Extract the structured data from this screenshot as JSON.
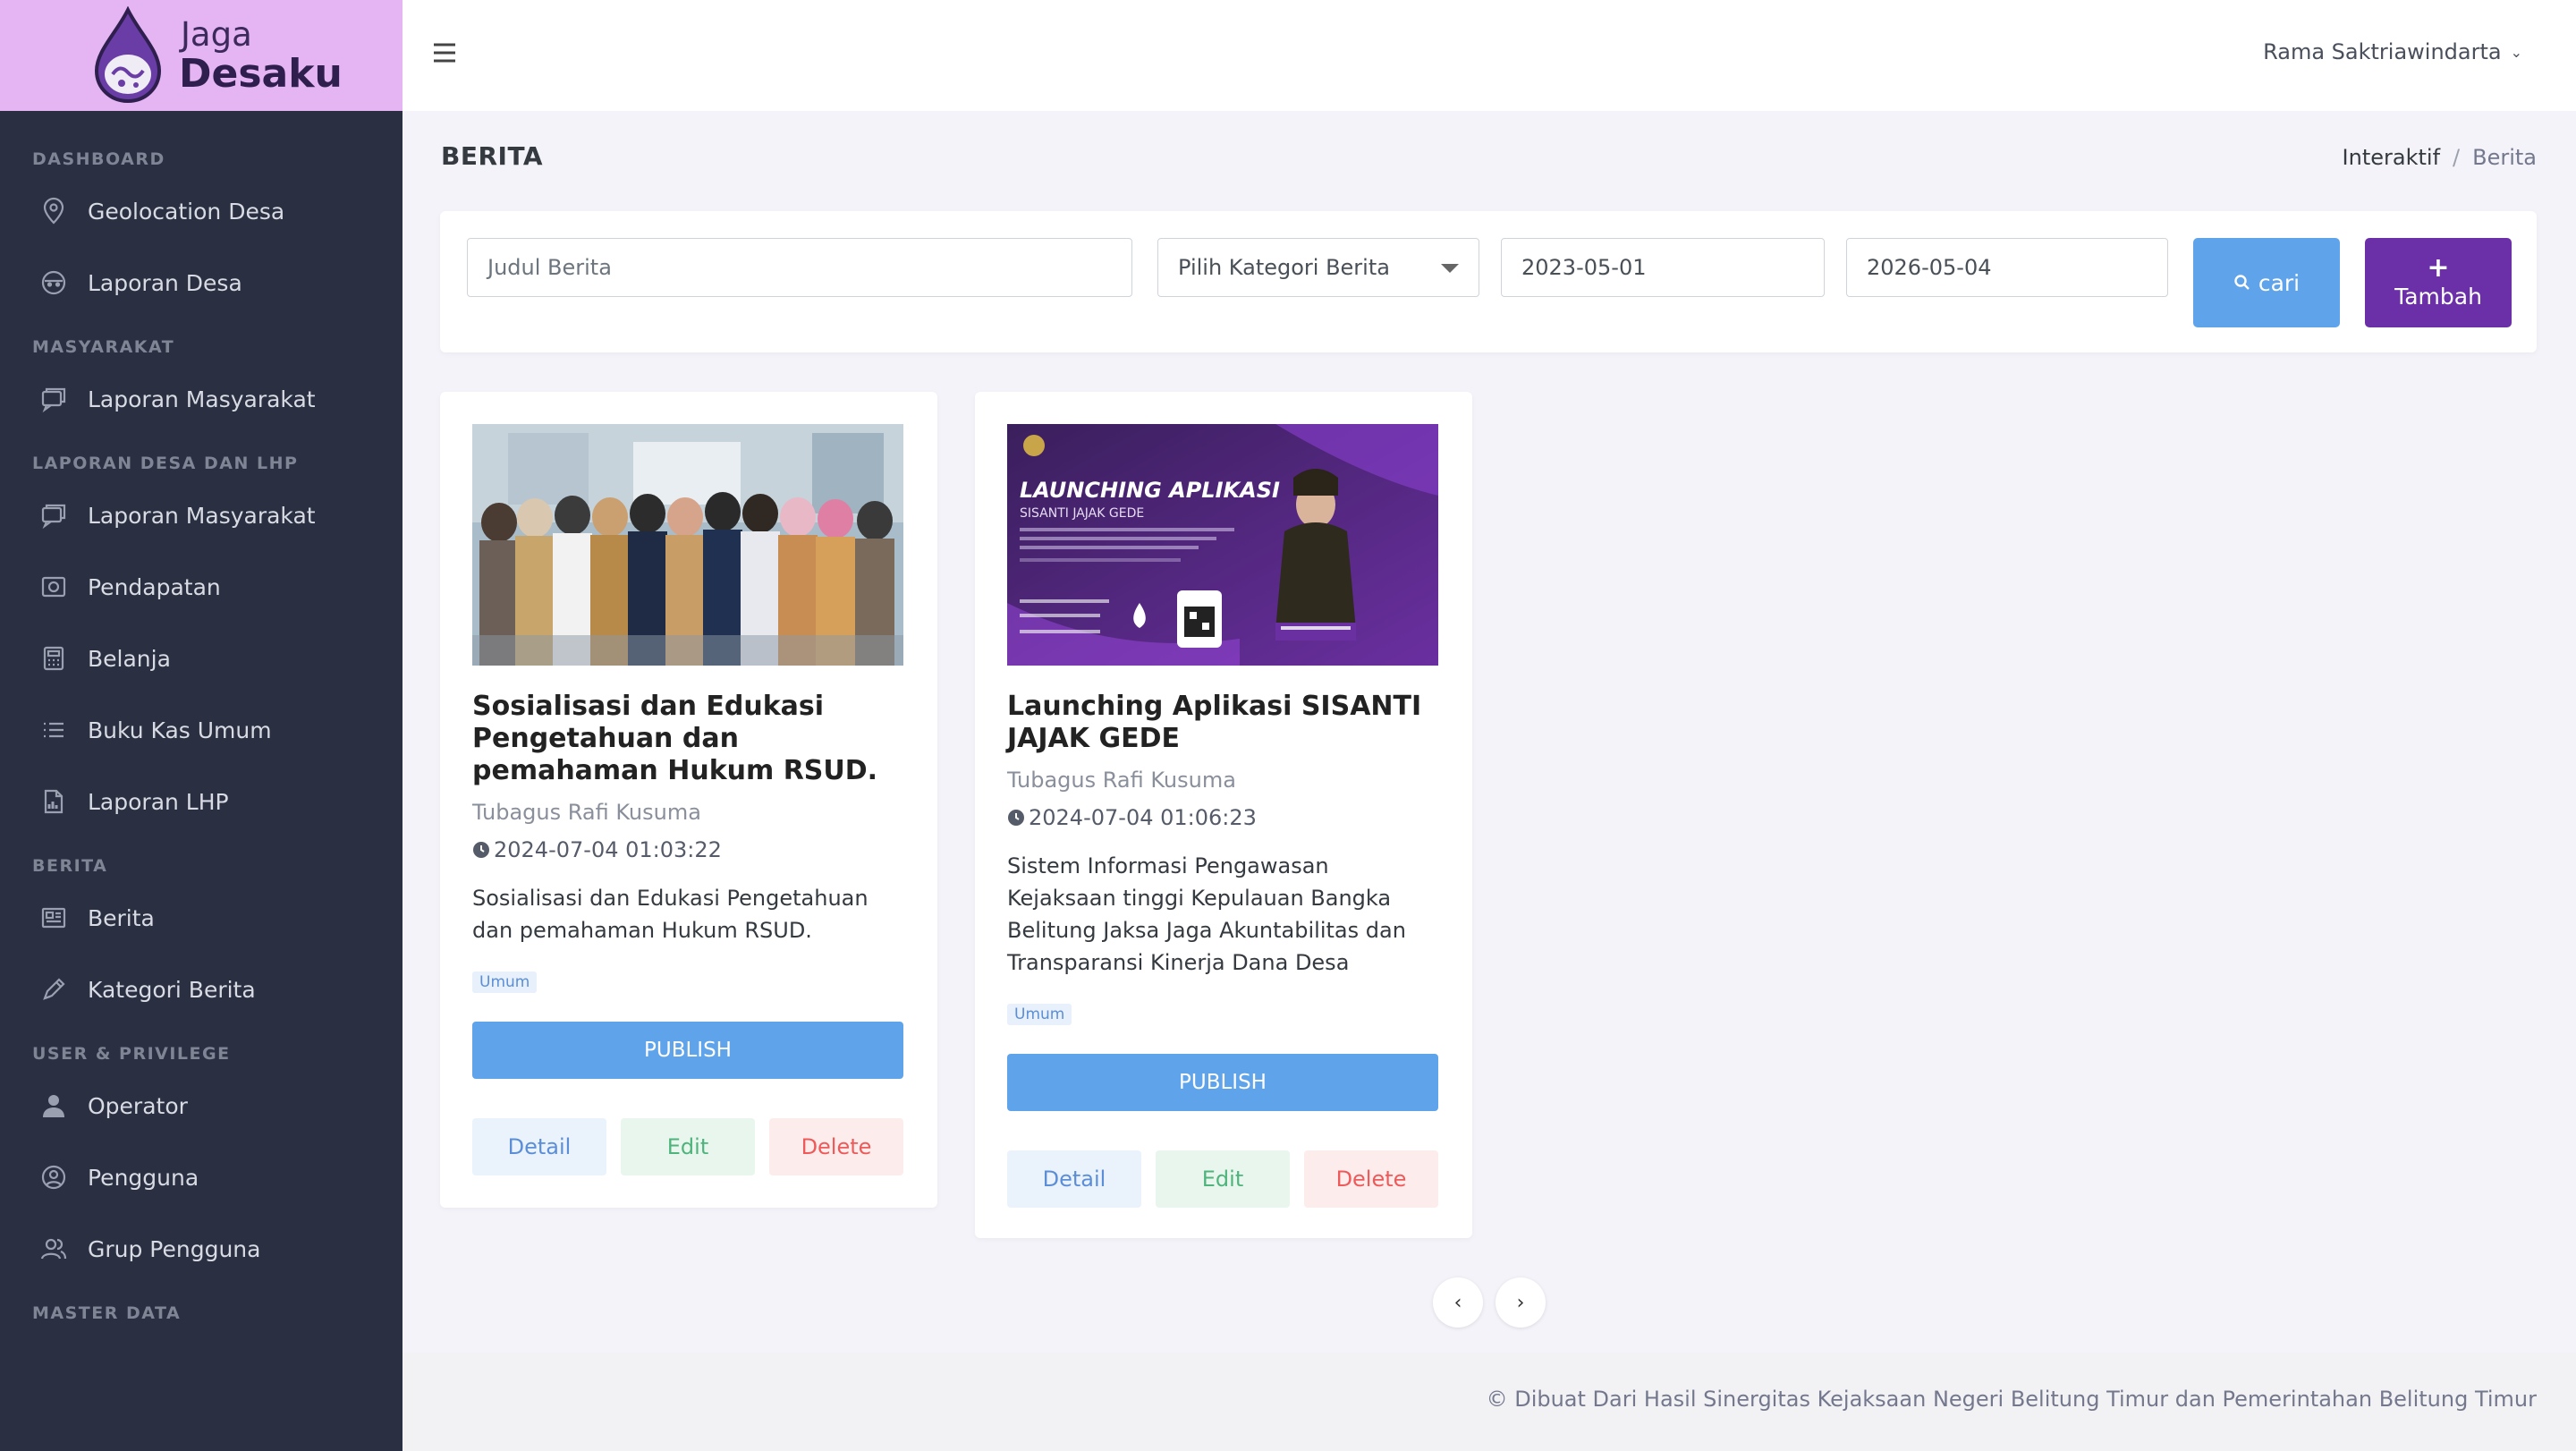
{
  "brand": {
    "line1": "Jaga",
    "line2": "Desaku"
  },
  "sidebar": {
    "sections": [
      {
        "title": "DASHBOARD",
        "items": [
          {
            "label": "Geolocation Desa",
            "icon": "map-pin-icon"
          },
          {
            "label": "Laporan Desa",
            "icon": "face-icon"
          }
        ]
      },
      {
        "title": "MASYARAKAT",
        "items": [
          {
            "label": "Laporan Masyarakat",
            "icon": "chat-icon"
          }
        ]
      },
      {
        "title": "LAPORAN DESA DAN LHP",
        "items": [
          {
            "label": "Laporan Masyarakat",
            "icon": "chat-icon"
          },
          {
            "label": "Pendapatan",
            "icon": "camera-icon"
          },
          {
            "label": "Belanja",
            "icon": "calculator-icon"
          },
          {
            "label": "Buku Kas Umum",
            "icon": "list-icon"
          },
          {
            "label": "Laporan LHP",
            "icon": "document-chart-icon"
          }
        ]
      },
      {
        "title": "BERITA",
        "items": [
          {
            "label": "Berita",
            "icon": "newspaper-icon"
          },
          {
            "label": "Kategori Berita",
            "icon": "pen-icon"
          }
        ]
      },
      {
        "title": "USER & PRIVILEGE",
        "items": [
          {
            "label": "Operator",
            "icon": "person-icon"
          },
          {
            "label": "Pengguna",
            "icon": "user-circle-icon"
          },
          {
            "label": "Grup Pengguna",
            "icon": "user-group-icon"
          }
        ]
      },
      {
        "title": "MASTER DATA",
        "items": []
      }
    ]
  },
  "topbar": {
    "user_name": "Rama Saktriawindarta"
  },
  "page": {
    "title": "BERITA",
    "breadcrumb": [
      "Interaktif",
      "Berita"
    ]
  },
  "filter": {
    "title_placeholder": "Judul Berita",
    "category_selected": "Pilih Kategori Berita",
    "date_from": "2023-05-01",
    "date_to": "2026-05-04",
    "search_label": "cari",
    "add_label": "Tambah"
  },
  "news": [
    {
      "title": "Sosialisasi dan Edukasi Pengetahuan dan pemahaman Hukum RSUD.",
      "author": "Tubagus Rafi Kusuma",
      "date": "2024-07-04 01:03:22",
      "description": "Sosialisasi dan Edukasi Pengetahuan dan pemahaman Hukum RSUD.",
      "badge": "Umum",
      "publish_label": "PUBLISH",
      "detail_label": "Detail",
      "edit_label": "Edit",
      "delete_label": "Delete"
    },
    {
      "title": "Launching Aplikasi SISANTI JAJAK GEDE",
      "author": "Tubagus Rafi Kusuma",
      "date": "2024-07-04 01:06:23",
      "description": "Sistem Informasi Pengawasan Kejaksaan tinggi Kepulauan Bangka Belitung Jaksa Jaga Akuntabilitas dan Transparansi Kinerja Dana Desa",
      "badge": "Umum",
      "publish_label": "PUBLISH",
      "detail_label": "Detail",
      "edit_label": "Edit",
      "delete_label": "Delete",
      "banner_text": {
        "headline": "LAUNCHING APLIKASI",
        "subline": "SISANTI JAJAK GEDE"
      }
    }
  ],
  "pagination": {
    "prev": "‹",
    "next": "›"
  },
  "footer": {
    "text": "© Dibuat Dari Hasil Sinergitas Kejaksaan Negeri Belitung Timur dan Pemerintahan Belitung Timur"
  },
  "colors": {
    "sidebar_bg": "#2a3042",
    "brand_bg": "#e4b5f2",
    "primary": "#5fa3ea",
    "purple": "#6b2fa8"
  }
}
